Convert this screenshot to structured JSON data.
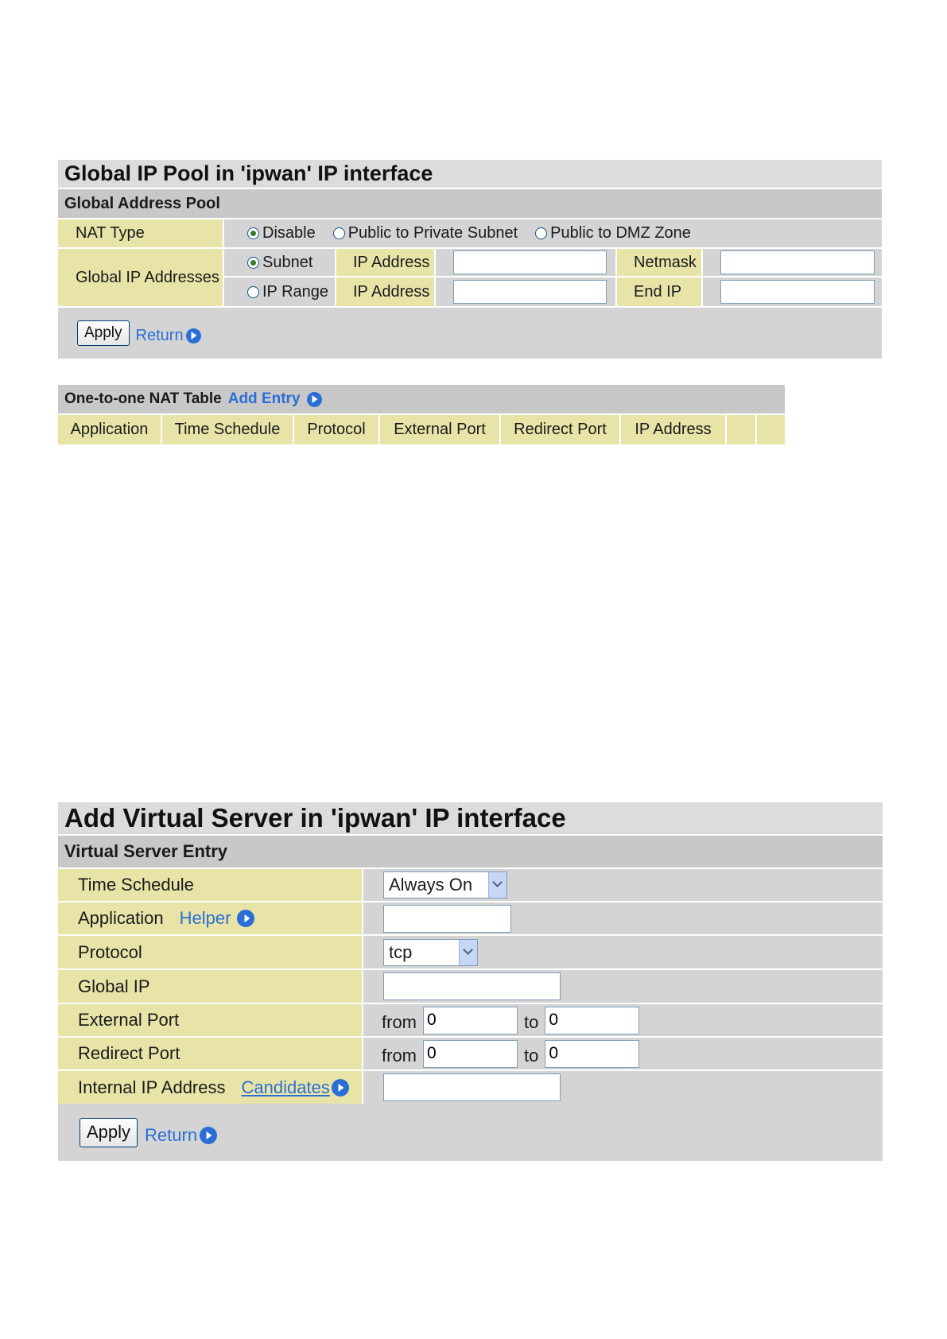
{
  "pool": {
    "title": "Global IP Pool in 'ipwan' IP interface",
    "section": "Global Address Pool",
    "nat_type_label": "NAT Type",
    "nat_options": [
      "Disable",
      "Public to Private Subnet",
      "Public to DMZ Zone"
    ],
    "nat_selected": "Disable",
    "global_ip_label": "Global IP Addresses",
    "subnet_label": "Subnet",
    "ip_range_label": "IP Range",
    "ip_address_label": "IP Address",
    "netmask_label": "Netmask",
    "end_ip_label": "End IP",
    "subnet_ip_value": "",
    "netmask_value": "",
    "range_ip_value": "",
    "end_ip_value": "",
    "apply_label": "Apply",
    "return_label": "Return"
  },
  "nat_table": {
    "title": "One-to-one NAT Table",
    "add_entry_label": "Add Entry",
    "columns": [
      "Application",
      "Time Schedule",
      "Protocol",
      "External Port",
      "Redirect Port",
      "IP Address",
      "",
      ""
    ]
  },
  "vserver": {
    "title": "Add Virtual Server in 'ipwan' IP interface",
    "section": "Virtual Server Entry",
    "time_schedule_label": "Time Schedule",
    "time_schedule_value": "Always On",
    "application_label": "Application",
    "helper_label": "Helper",
    "application_value": "",
    "protocol_label": "Protocol",
    "protocol_value": "tcp",
    "global_ip_label": "Global IP",
    "global_ip_value": "",
    "external_port_label": "External Port",
    "redirect_port_label": "Redirect Port",
    "from_label": "from",
    "to_label": "to",
    "ext_from": "0",
    "ext_to": "0",
    "red_from": "0",
    "red_to": "0",
    "internal_ip_label": "Internal IP Address",
    "candidates_label": "Candidates",
    "internal_ip_value": "",
    "apply_label": "Apply",
    "return_label": "Return"
  }
}
